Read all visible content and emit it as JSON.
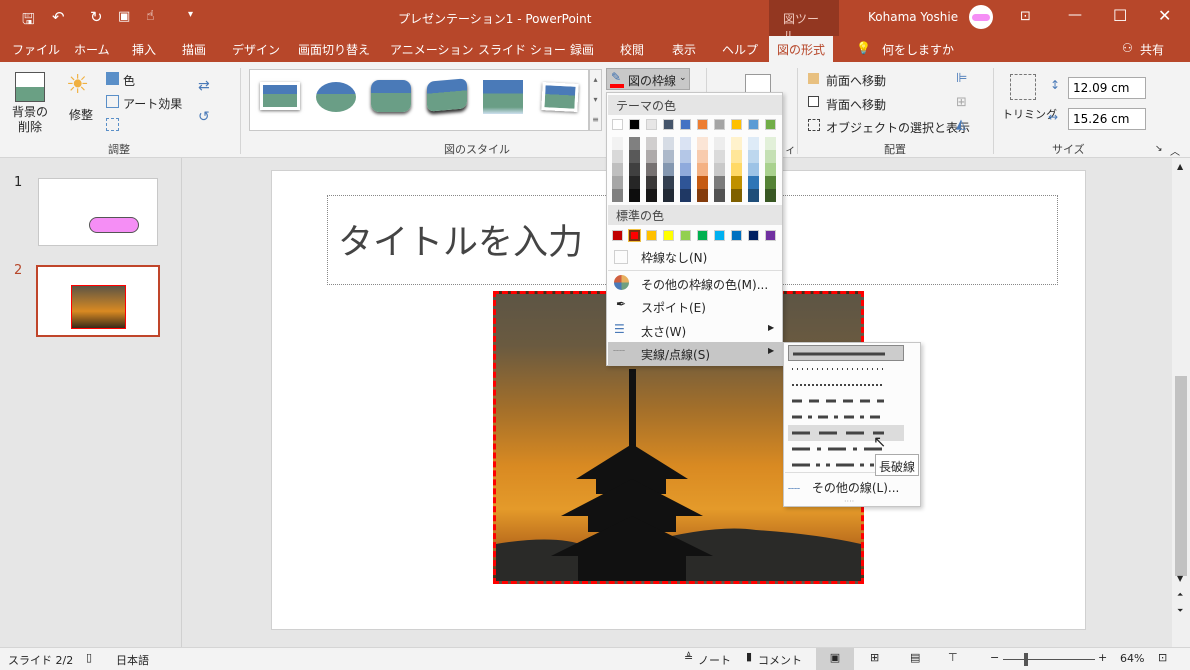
{
  "title": {
    "doc": "プレゼンテーション1 - PowerPoint",
    "context_tab": "図ツール",
    "user": "Kohama Yoshie"
  },
  "tabs": [
    "ファイル",
    "ホーム",
    "挿入",
    "描画",
    "デザイン",
    "画面切り替え",
    "アニメーション",
    "スライド ショー",
    "録画",
    "校閲",
    "表示",
    "ヘルプ",
    "図の形式"
  ],
  "tell_me": "何をしますか",
  "share": "共有",
  "ribbon": {
    "remove_bg": "背景の削除",
    "corrections": "修整",
    "color": "色",
    "artistic": "アート効果",
    "group_adjust": "調整",
    "group_styles": "図のスタイル",
    "border_button": "図の枠線",
    "bring_forward": "前面へ移動",
    "send_backward": "背面へ移動",
    "selection_pane": "オブジェクトの選択と表示",
    "group_arrange": "配置",
    "crop": "トリミング",
    "height": "12.09 cm",
    "width": "15.26 cm",
    "group_size": "サイズ",
    "group_access_partial": "ィ"
  },
  "thumbs": [
    {
      "num": "1"
    },
    {
      "num": "2"
    }
  ],
  "slide": {
    "title_placeholder": "タイトルを入力"
  },
  "menu": {
    "theme_header": "テーマの色",
    "standard_header": "標準の色",
    "no_outline": "枠線なし(N)",
    "more_colors": "その他の枠線の色(M)...",
    "eyedropper": "スポイト(E)",
    "weight": "太さ(W)",
    "dashes": "実線/点線(S)",
    "theme_colors": [
      "#FFFFFF",
      "#000000",
      "#E7E6E6",
      "#44546A",
      "#4472C4",
      "#ED7D31",
      "#A5A5A5",
      "#FFC000",
      "#5B9BD5",
      "#70AD47"
    ],
    "shades": [
      [
        "#F2F2F2",
        "#D9D9D9",
        "#BFBFBF",
        "#A6A6A6",
        "#808080"
      ],
      [
        "#808080",
        "#595959",
        "#404040",
        "#262626",
        "#0D0D0D"
      ],
      [
        "#D0CECE",
        "#AEAAAA",
        "#767171",
        "#3A3838",
        "#171616"
      ],
      [
        "#D6DCE5",
        "#ADB9CA",
        "#8497B0",
        "#333F50",
        "#222A35"
      ],
      [
        "#DAE3F3",
        "#B4C7E7",
        "#8FAADC",
        "#2F5597",
        "#1F3864"
      ],
      [
        "#FBE5D6",
        "#F8CBAD",
        "#F4B183",
        "#C55A11",
        "#843C0C"
      ],
      [
        "#EDEDED",
        "#DBDBDB",
        "#C9C9C9",
        "#7B7B7B",
        "#525252"
      ],
      [
        "#FFF2CC",
        "#FFE699",
        "#FFD966",
        "#BF9000",
        "#7F6000"
      ],
      [
        "#DEEBF7",
        "#BDD7EE",
        "#9DC3E6",
        "#2E75B6",
        "#1F4E79"
      ],
      [
        "#E2F0D9",
        "#C5E0B4",
        "#A9D18E",
        "#548235",
        "#385723"
      ]
    ],
    "standard_colors": [
      "#C00000",
      "#FF0000",
      "#FFC000",
      "#FFFF00",
      "#92D050",
      "#00B050",
      "#00B0F0",
      "#0070C0",
      "#002060",
      "#7030A0"
    ],
    "selected_standard": 1
  },
  "submenu": {
    "dash_styles": [
      "solid",
      "round-dot",
      "square-dot",
      "dash",
      "dash-dot",
      "long-dash",
      "long-dash-dot",
      "long-dash-dot-dot"
    ],
    "selected": "solid",
    "hovered": "long-dash",
    "more_lines": "その他の線(L)...",
    "tooltip": "長破線"
  },
  "status": {
    "slide": "スライド 2/2",
    "lang": "日本語",
    "notes": "ノート",
    "comments": "コメント",
    "zoom": "64%",
    "zoom_level": 64
  },
  "accent": "#B7472A",
  "outline_color": "#FF0000"
}
